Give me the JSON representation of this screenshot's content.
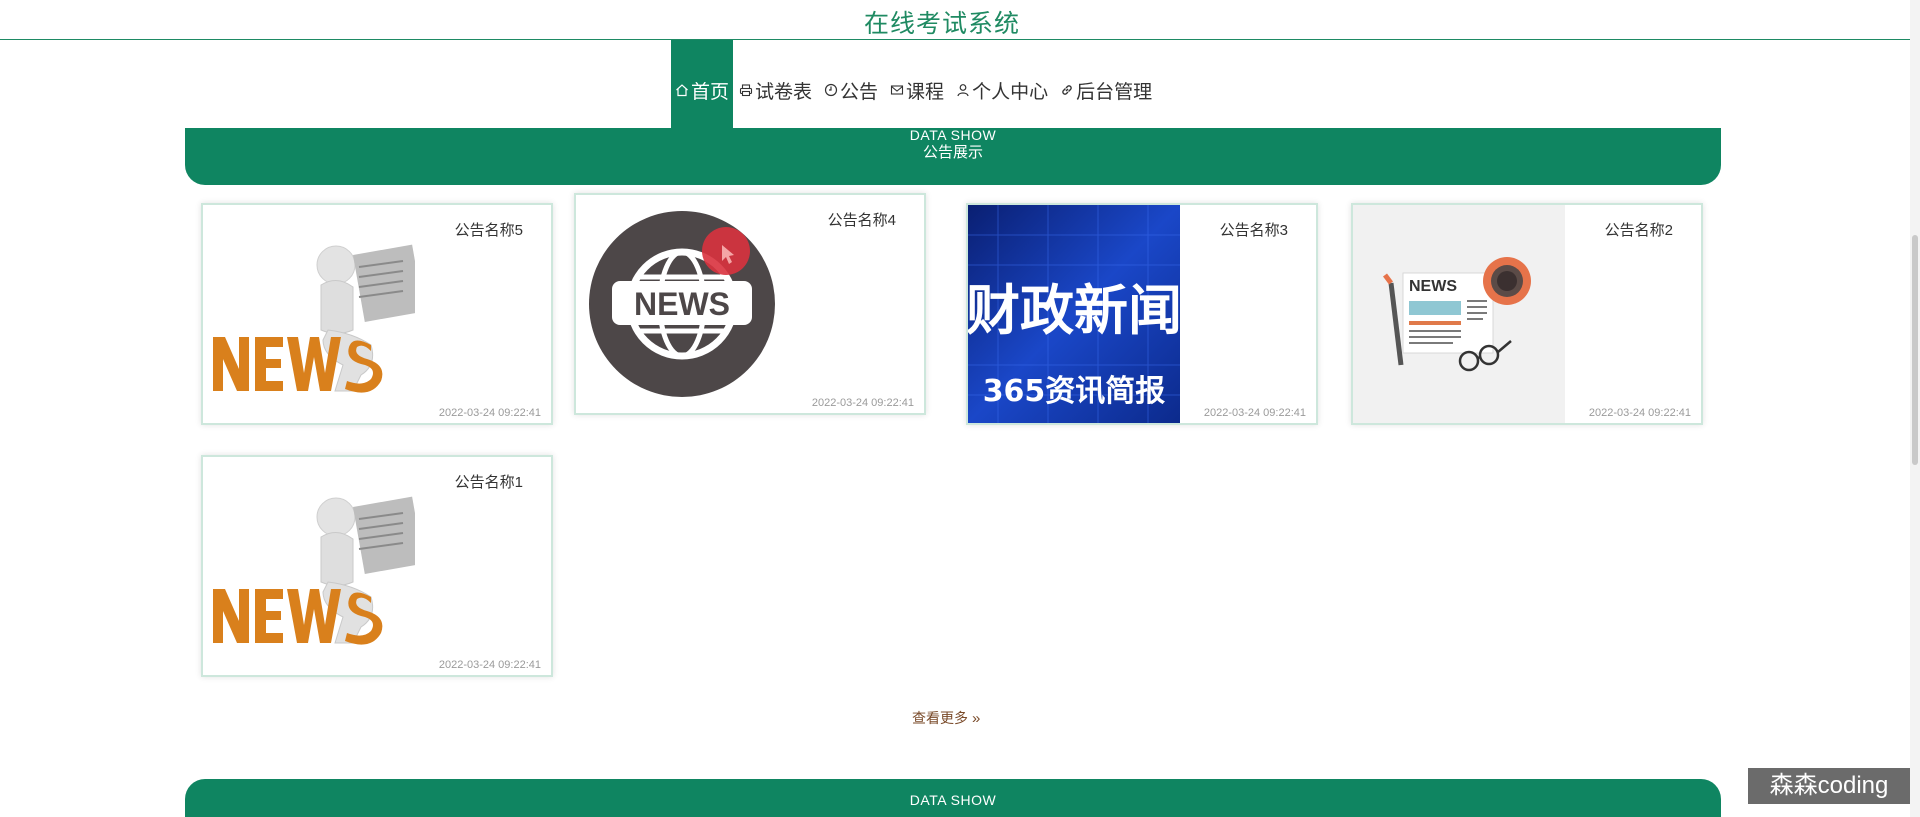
{
  "site": {
    "title": "在线考试系统"
  },
  "nav": {
    "items": [
      {
        "label": "首页",
        "icon": "home-icon",
        "active": true
      },
      {
        "label": "试卷表",
        "icon": "printer-icon",
        "active": false
      },
      {
        "label": "公告",
        "icon": "clock-icon",
        "active": false
      },
      {
        "label": "课程",
        "icon": "mail-icon",
        "active": false
      },
      {
        "label": "个人中心",
        "icon": "user-icon",
        "active": false
      },
      {
        "label": "后台管理",
        "icon": "link-icon",
        "active": false
      }
    ]
  },
  "notice_section": {
    "sub": "DATA SHOW",
    "title": "公告展示"
  },
  "notices": [
    {
      "title": "公告名称5",
      "time": "2022-03-24 09:22:41",
      "image": "news-3d-figure"
    },
    {
      "title": "公告名称4",
      "time": "2022-03-24 09:22:41",
      "image": "news-globe-badge"
    },
    {
      "title": "公告名称3",
      "time": "2022-03-24 09:22:41",
      "image": "finance-news-banner",
      "image_text": {
        "line1": "财政新闻",
        "line2": "365资讯简报"
      }
    },
    {
      "title": "公告名称2",
      "time": "2022-03-24 09:22:41",
      "image": "newspaper-flat-illustration",
      "image_text": {
        "label": "NEWS"
      }
    },
    {
      "title": "公告名称1",
      "time": "2022-03-24 09:22:41",
      "image": "news-3d-figure"
    }
  ],
  "more": {
    "label": "查看更多",
    "icon": "double-chevron-right-icon"
  },
  "bottom_section": {
    "sub": "DATA SHOW"
  },
  "watermark": {
    "text": "森森coding"
  },
  "colors": {
    "primary": "#0f8561",
    "title": "#1f8a62",
    "more": "#7a4b2a"
  }
}
